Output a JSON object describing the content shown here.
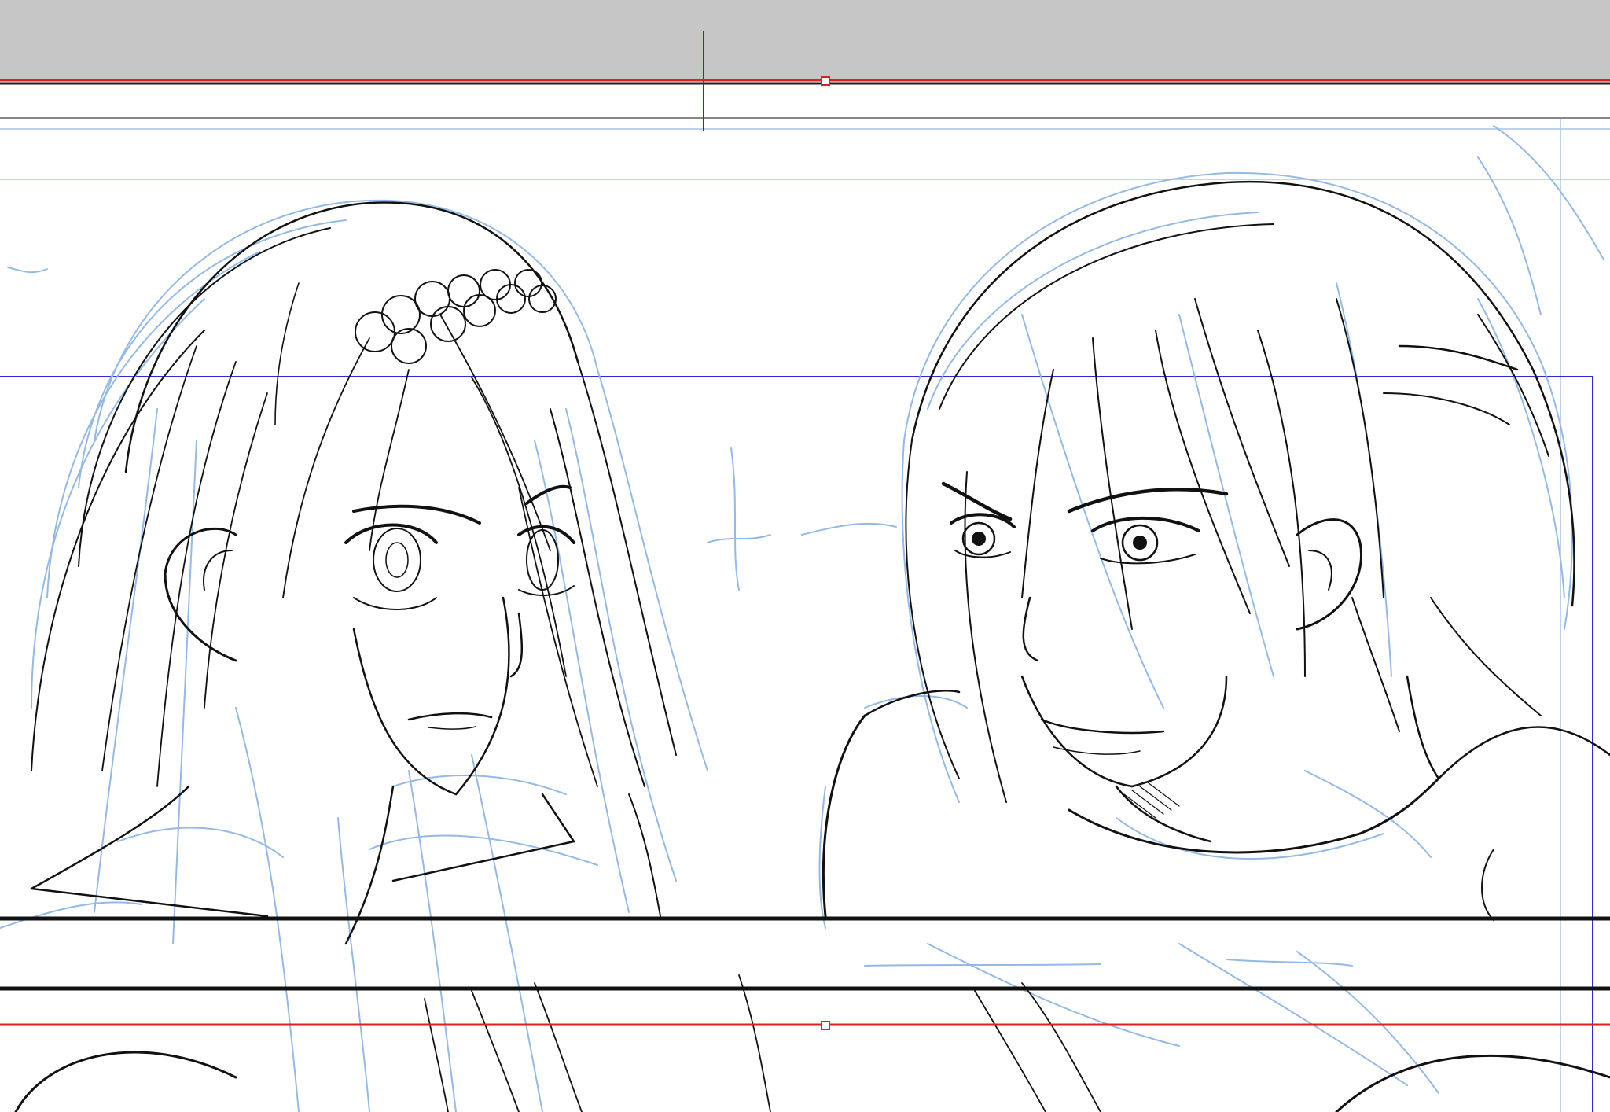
{
  "canvas": {
    "pasteboard_color": "#c6c6c6",
    "paper_color": "#ffffff",
    "lineart_color": "#111111",
    "sketch_color": "#8fb6e6",
    "guide_color": "#2b2bd9",
    "selection_color": "#e02020",
    "guide_lines_color": "#a9c4ea"
  },
  "panels": [
    {
      "label": "panel-top"
    },
    {
      "label": "panel-main"
    },
    {
      "label": "panel-bottom"
    }
  ],
  "figures": [
    {
      "name": "girl-long-hair-with-hair-ornament"
    },
    {
      "name": "boy-short-hair"
    }
  ],
  "handles": [
    {
      "name": "selection-handle-top",
      "icon": "square-handle"
    },
    {
      "name": "selection-handle-bottom",
      "icon": "square-handle"
    }
  ]
}
